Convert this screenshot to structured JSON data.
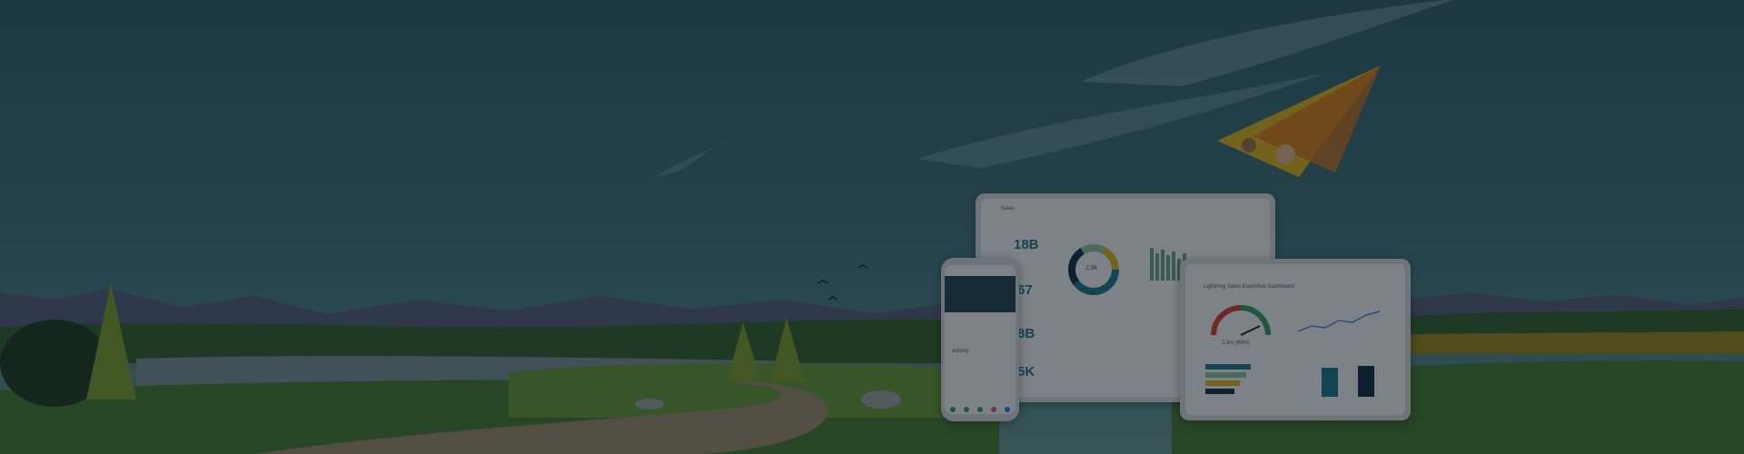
{
  "scene": {
    "description_alt": "Salesforce hero banner with a hang-glider mascot over a landscape and device mockups",
    "colors": {
      "sky_top": "#2f5a66",
      "sky_bottom": "#4f7f86",
      "mountain": "#4d5672",
      "grass": "#3f6f2c",
      "grass_light": "#5b8a33",
      "field": "#8a7a1a",
      "water": "#6f8488",
      "path": "#8c7f65",
      "accent": "#1d6a7d"
    }
  },
  "desktop_dashboard": {
    "app_name": "Sales",
    "kpis": [
      "18B",
      "67",
      "8B",
      "5K"
    ],
    "donut_center": "2.9k"
  },
  "tablet_dashboard": {
    "title": "Lightning Sales Executive Dashboard",
    "gauge_value": "2.9m (99%)"
  },
  "phone": {
    "section": "Activity"
  }
}
